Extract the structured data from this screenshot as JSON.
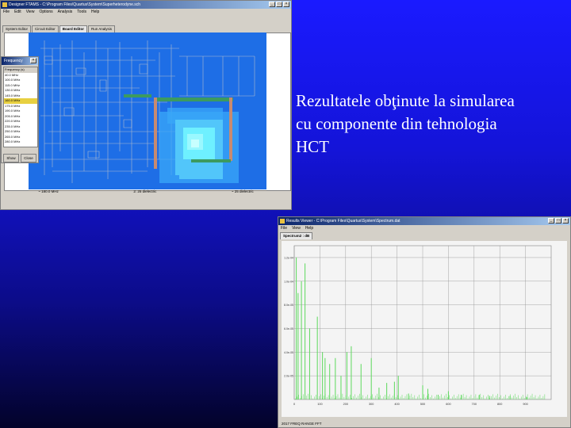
{
  "slide": {
    "text_lines": [
      "Rezultatele obţinute la simularea",
      "cu componente din tehnologia",
      "HCT"
    ]
  },
  "designer_window": {
    "title": "Designer FTAMS - C:\\Program Files\\Quartus\\System\\Superheterodyne.sch",
    "menu": [
      "File",
      "Edit",
      "View",
      "Options",
      "Analysis",
      "Tools",
      "Help"
    ],
    "tabs": [
      "System Editor",
      "Circuit Editor",
      "Board Editor",
      "Run Analysis"
    ],
    "active_tab": 2,
    "status": [
      "~ 180.0 MHz",
      "2: 25 dielectric",
      "~ 25 dielectric"
    ],
    "colors": {
      "board_bg": "#1e6ee6",
      "trace": "#c8c8c8",
      "field_hot": "#6ef0ff",
      "field_cool": "#3aa8f8"
    }
  },
  "frequency_panel": {
    "title": "Frequency",
    "header": "Frequency (s)",
    "items": [
      "40.0 MHz",
      "100.0 MHz",
      "115.0 MHz",
      "130.0 MHz",
      "145.0 MHz",
      "160.0 MHz",
      "175.0 MHz",
      "190.0 MHz",
      "205.0 MHz",
      "220.0 MHz",
      "235.0 MHz",
      "250.0 MHz",
      "265.0 MHz",
      "280.0 MHz"
    ],
    "selected_index": 5,
    "buttons": [
      "Show",
      "Close"
    ]
  },
  "results_window": {
    "title": "Results Viewer - C:\\Program Files\\Quartus\\System\\Spectrum.dat",
    "menu": [
      "File",
      "View",
      "Help"
    ],
    "tab": "Spectrum2 : dB",
    "status": "2017 FREQ RANGE FFT",
    "colors": {
      "plot_bg": "#f4f4f4",
      "bars": "#5cd95c",
      "grid": "#909090"
    }
  },
  "chart_data": {
    "type": "bar",
    "title": "",
    "xlabel": "",
    "ylabel": "",
    "x_ticks": [
      "0",
      "100",
      "200",
      "300",
      "400",
      "500",
      "600",
      "700",
      "800",
      "900"
    ],
    "y_ticks": [
      "1.2e-04",
      "1.0e-04",
      "8.0e-05",
      "6.0e-05",
      "4.0e-05",
      "2.0e-05"
    ],
    "xlim": [
      0,
      1000
    ],
    "ylim": [
      0,
      0.00013
    ],
    "grid": true,
    "x": [
      8,
      15,
      28,
      42,
      60,
      90,
      110,
      120,
      138,
      160,
      182,
      205,
      222,
      260,
      300,
      330,
      360,
      390,
      405,
      445,
      500,
      520,
      560,
      600,
      650,
      720,
      760,
      840,
      905
    ],
    "values": [
      0.00012,
      9e-05,
      0.0001,
      0.000115,
      6e-05,
      7e-05,
      4e-05,
      3.5e-05,
      3e-05,
      3.5e-05,
      2e-05,
      4e-05,
      4.5e-05,
      3e-05,
      3.5e-05,
      1e-05,
      1.4e-05,
      1.5e-05,
      2e-05,
      5e-06,
      1.2e-05,
      9e-06,
      4e-06,
      7e-06,
      4e-06,
      4e-06,
      3e-06,
      3e-06,
      2e-06
    ]
  }
}
